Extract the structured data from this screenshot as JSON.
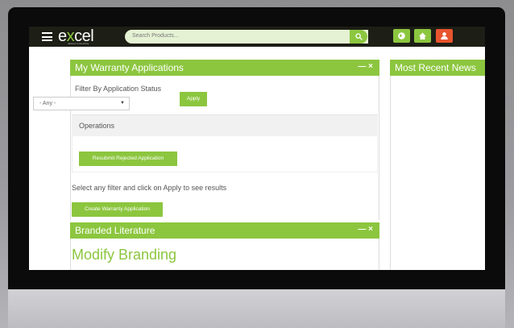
{
  "header": {
    "logo_main": "e",
    "logo_accent": "x",
    "logo_rest": "cel",
    "logo_tagline": "tailored connectivity",
    "search_placeholder": "Search Products..."
  },
  "warranty_panel": {
    "title": "My Warranty Applications",
    "controls": "— ×",
    "filter_label": "Filter By Application Status",
    "filter_value": "- Any -",
    "apply_label": "Apply",
    "operations_label": "Operations",
    "resubmit_label": "Resubmit Rejected Application",
    "hint_text": "Select any filter and click on Apply to see results",
    "create_label": "Create Warranty Application"
  },
  "literature_panel": {
    "title": "Branded Literature",
    "controls": "— ×",
    "heading": "Modify Branding"
  },
  "news_panel": {
    "title": "Most Recent News"
  },
  "icons": [
    "menu-icon",
    "search-icon",
    "globe-icon",
    "home-icon",
    "user-icon"
  ],
  "colors": {
    "accent": "#8cc63f",
    "topbar": "#1d1e16",
    "user_button": "#e8542f"
  }
}
